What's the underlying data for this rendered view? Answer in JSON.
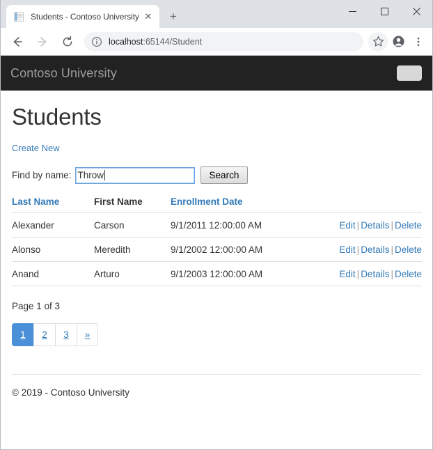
{
  "browser": {
    "tab": {
      "title": "Students - Contoso University",
      "favicon": "document-icon",
      "close_label": "✕"
    },
    "new_tab_label": "+",
    "window_controls": {
      "minimize": "─",
      "maximize": "□",
      "close": "✕"
    },
    "nav": {
      "back": "back-arrow",
      "forward": "forward-arrow",
      "reload": "reload-icon"
    },
    "omnibox": {
      "info_icon": "info-circle-icon",
      "url_host": "localhost",
      "url_rest": ":65144/Student",
      "full_url": "localhost:65144/Student"
    },
    "actions": {
      "bookmark": "star-icon",
      "profile": "profile-avatar-icon",
      "menu": "three-dot-menu-icon"
    }
  },
  "site": {
    "navbar": {
      "brand": "Contoso University",
      "toggler": "navbar-toggler"
    },
    "page_title": "Students",
    "create_new_label": "Create New",
    "search": {
      "label": "Find by name:",
      "value": "Throw",
      "placeholder": "",
      "button_label": "Search"
    },
    "table": {
      "headers": [
        {
          "label": "Last Name",
          "link": true
        },
        {
          "label": "First Name",
          "link": false
        },
        {
          "label": "Enrollment Date",
          "link": true
        },
        {
          "label": "",
          "link": false
        }
      ],
      "rows": [
        {
          "last_name": "Alexander",
          "first_name": "Carson",
          "enrollment_date": "9/1/2011 12:00:00 AM",
          "actions": {
            "edit": "Edit",
            "details": "Details",
            "delete": "Delete"
          }
        },
        {
          "last_name": "Alonso",
          "first_name": "Meredith",
          "enrollment_date": "9/1/2002 12:00:00 AM",
          "actions": {
            "edit": "Edit",
            "details": "Details",
            "delete": "Delete"
          }
        },
        {
          "last_name": "Anand",
          "first_name": "Arturo",
          "enrollment_date": "9/1/2003 12:00:00 AM",
          "actions": {
            "edit": "Edit",
            "details": "Details",
            "delete": "Delete"
          }
        }
      ],
      "separator": "|"
    },
    "paging": {
      "page_info": "Page 1 of 3",
      "buttons": [
        {
          "label": "1",
          "active": true
        },
        {
          "label": "2",
          "active": false
        },
        {
          "label": "3",
          "active": false
        },
        {
          "label": "»",
          "active": false
        }
      ]
    },
    "footer": "© 2019 - Contoso University"
  },
  "colors": {
    "navbar_bg": "#222222",
    "brand_text": "#9d9d9d",
    "link_blue": "#337ab7",
    "pagination_active": "#4a90d9",
    "focus_border": "#6aa3e0"
  }
}
